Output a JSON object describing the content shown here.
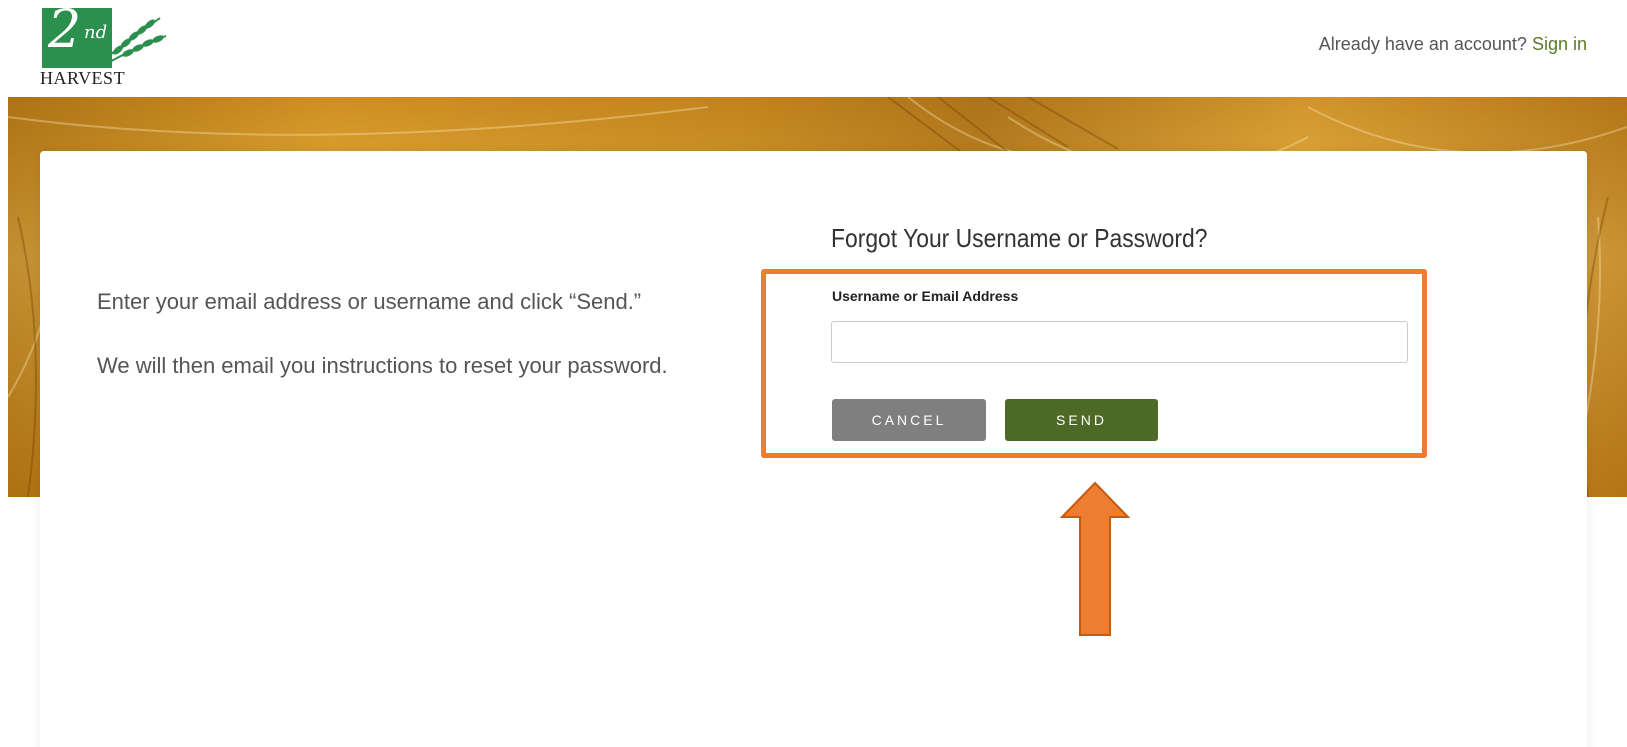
{
  "header": {
    "logo": {
      "numeral": "2",
      "suffix": "nd",
      "word": "HARVEST",
      "brand_color": "#2b8f4e"
    },
    "signin_prompt": "Already have an account?",
    "signin_link": "Sign in",
    "link_color": "#5a7a2a"
  },
  "intro": {
    "line1": "Enter your email address or username and click “Send.”",
    "line2": "We will then email you instructions to reset your password."
  },
  "form": {
    "title": "Forgot Your Username or Password?",
    "field_label": "Username or Email Address",
    "field_value": "",
    "field_placeholder": "",
    "cancel_label": "CANCEL",
    "send_label": "SEND",
    "cancel_color": "#7f7f7f",
    "send_color": "#4c6a25"
  },
  "annotation": {
    "highlight_color": "#ed7d31",
    "arrow_icon": "up-arrow-icon"
  }
}
